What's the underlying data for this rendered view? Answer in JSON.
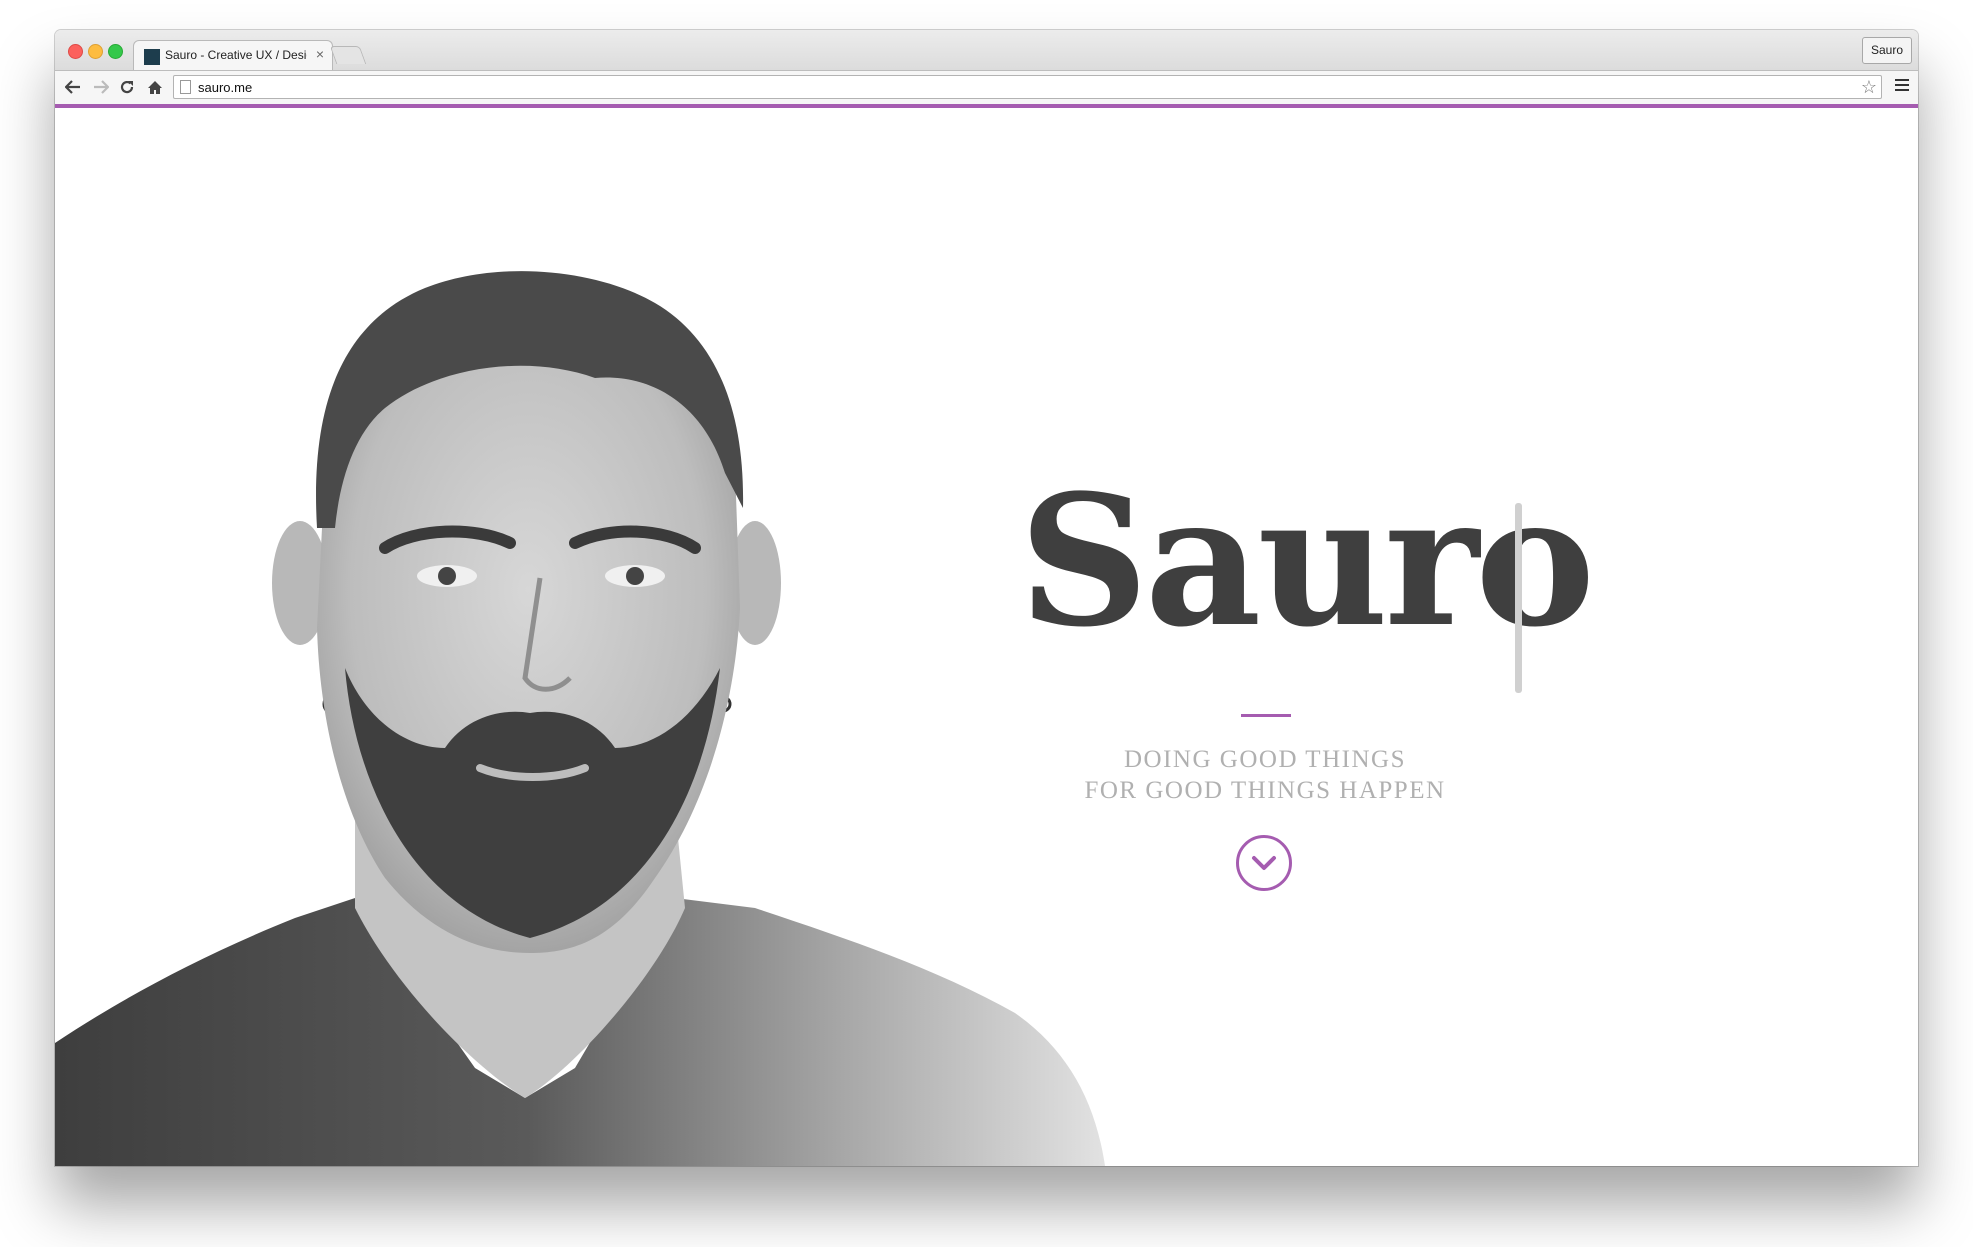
{
  "browser": {
    "tab_title": "Sauro - Creative UX / Designer",
    "tab_close": "×",
    "profile_label": "Sauro",
    "address": "sauro.me"
  },
  "icons": {
    "back": "arrow-left-icon",
    "forward": "arrow-right-icon",
    "reload": "reload-icon",
    "home": "home-icon",
    "bookmark": "star-icon",
    "menu": "hamburger-menu-icon",
    "scroll": "chevron-down-circle-icon"
  },
  "hero": {
    "title": "Sauro",
    "tagline_line1": "DOING GOOD THINGS",
    "tagline_line2": "FOR GOOD THINGS HAPPEN"
  },
  "colors": {
    "accent": "#a55cb0",
    "title": "#3f3f3f",
    "tagline": "#b0b0b0",
    "favicon": "#1d3d4d"
  }
}
